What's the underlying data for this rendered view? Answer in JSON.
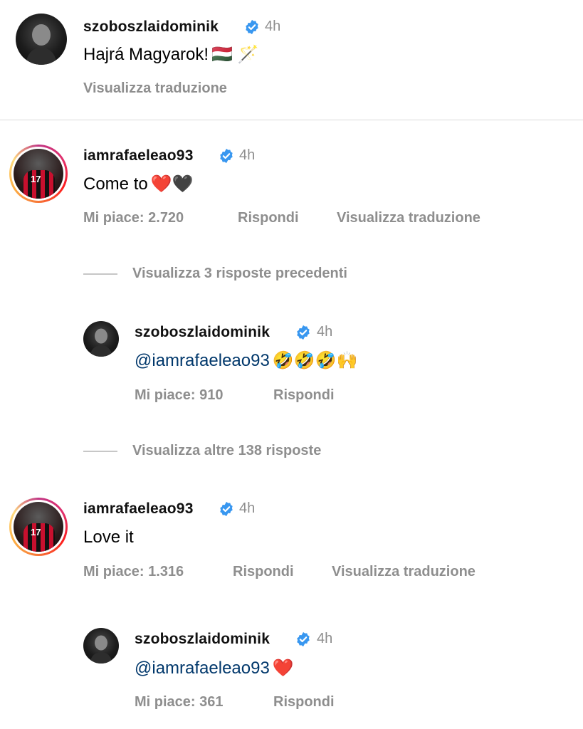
{
  "comments": [
    {
      "username": "szoboszlaidominik",
      "time": "4h",
      "text": "Hajrá Magyarok!",
      "emoji": "🇭🇺 🪄",
      "actions": {
        "translate": "Visualizza traduzione"
      }
    },
    {
      "username": "iamrafaeleao93",
      "time": "4h",
      "text": "Come to",
      "emoji": "❤️🖤",
      "likes": "Mi piace: 2.720",
      "reply": "Rispondi",
      "translate": "Visualizza traduzione",
      "view_previous": "Visualizza 3 risposte precedenti",
      "replies": [
        {
          "username": "szoboszlaidominik",
          "time": "4h",
          "mention": "@iamrafaeleao93",
          "emoji": "🤣🤣🤣🙌",
          "likes": "Mi piace: 910",
          "reply": "Rispondi"
        }
      ],
      "view_more": "Visualizza altre 138 risposte"
    },
    {
      "username": "iamrafaeleao93",
      "time": "4h",
      "text": "Love it",
      "likes": "Mi piace: 1.316",
      "reply": "Rispondi",
      "translate": "Visualizza traduzione",
      "replies": [
        {
          "username": "szoboszlaidominik",
          "time": "4h",
          "mention": "@iamrafaeleao93",
          "emoji": "❤️",
          "likes": "Mi piace: 361",
          "reply": "Rispondi"
        }
      ]
    }
  ],
  "icons": {
    "verified": "verified-badge-icon",
    "verified_color": "#3897f0"
  },
  "avatar_jersey_number": "17"
}
